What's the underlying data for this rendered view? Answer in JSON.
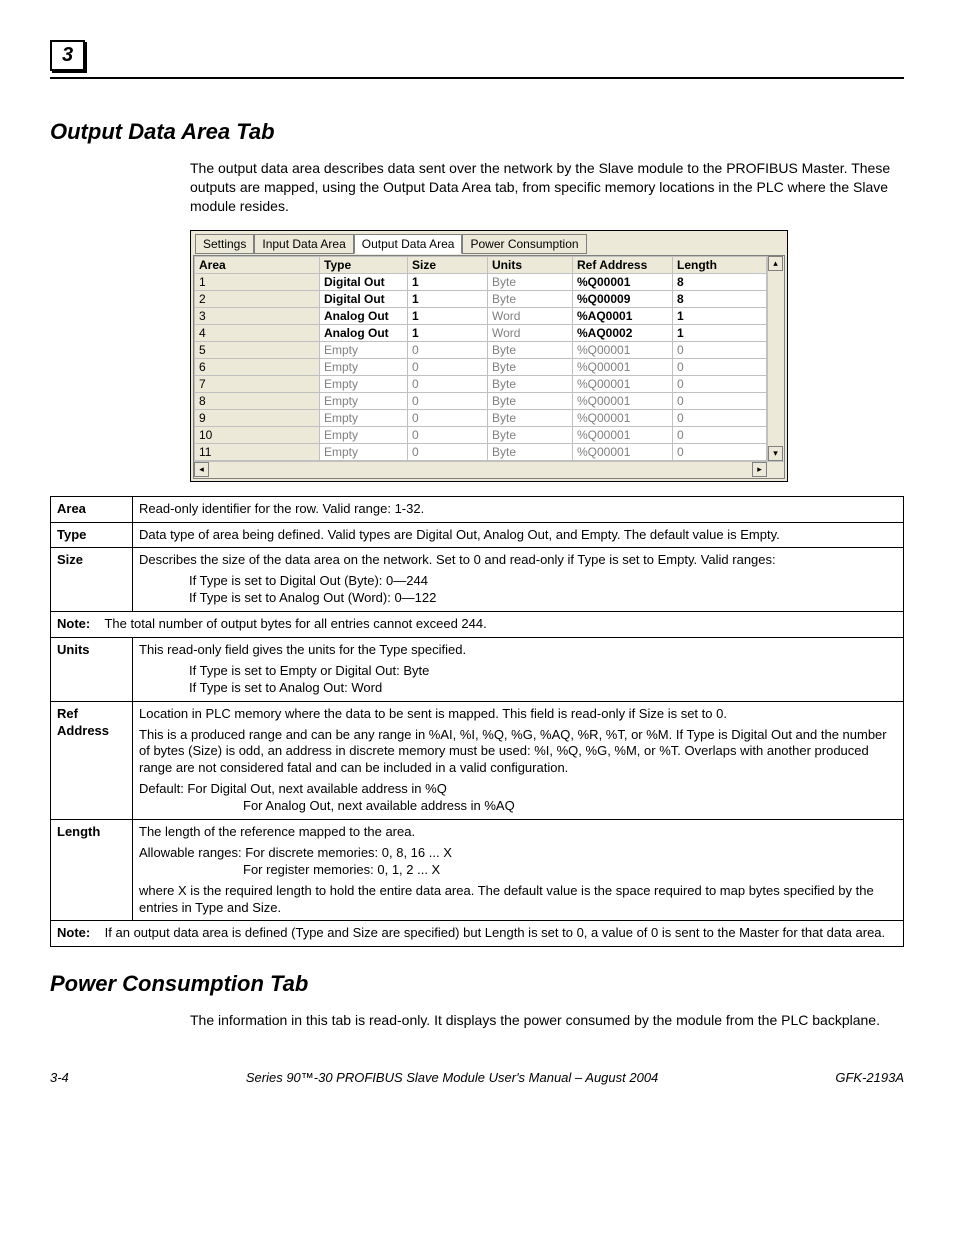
{
  "chapter_badge": "3",
  "section1_title": "Output Data Area Tab",
  "section1_para": "The output data area describes data sent over the network by the Slave module to the PROFIBUS Master. These outputs are mapped, using the Output Data Area tab, from specific memory locations in the PLC where the Slave module resides.",
  "tabs": {
    "settings": "Settings",
    "input": "Input Data Area",
    "output": "Output Data Area",
    "power": "Power Consumption"
  },
  "grid_headers": {
    "area": "Area",
    "type": "Type",
    "size": "Size",
    "units": "Units",
    "ref": "Ref Address",
    "len": "Length"
  },
  "rows": [
    {
      "n": "1",
      "type": "Digital Out",
      "tb": true,
      "size": "1",
      "sb": true,
      "units": "Byte",
      "ud": true,
      "ref": "%Q00001",
      "rb": true,
      "len": "8",
      "lb": true
    },
    {
      "n": "2",
      "type": "Digital Out",
      "tb": true,
      "size": "1",
      "sb": true,
      "units": "Byte",
      "ud": true,
      "ref": "%Q00009",
      "rb": true,
      "len": "8",
      "lb": true
    },
    {
      "n": "3",
      "type": "Analog Out",
      "tb": true,
      "size": "1",
      "sb": true,
      "units": "Word",
      "ud": true,
      "ref": "%AQ0001",
      "rb": true,
      "len": "1",
      "lb": true
    },
    {
      "n": "4",
      "type": "Analog Out",
      "tb": true,
      "size": "1",
      "sb": true,
      "units": "Word",
      "ud": true,
      "ref": "%AQ0002",
      "rb": true,
      "len": "1",
      "lb": true
    },
    {
      "n": "5",
      "type": "Empty",
      "tb": false,
      "size": "0",
      "sb": false,
      "units": "Byte",
      "ud": true,
      "ref": "%Q00001",
      "rb": false,
      "len": "0",
      "lb": false
    },
    {
      "n": "6",
      "type": "Empty",
      "tb": false,
      "size": "0",
      "sb": false,
      "units": "Byte",
      "ud": true,
      "ref": "%Q00001",
      "rb": false,
      "len": "0",
      "lb": false
    },
    {
      "n": "7",
      "type": "Empty",
      "tb": false,
      "size": "0",
      "sb": false,
      "units": "Byte",
      "ud": true,
      "ref": "%Q00001",
      "rb": false,
      "len": "0",
      "lb": false
    },
    {
      "n": "8",
      "type": "Empty",
      "tb": false,
      "size": "0",
      "sb": false,
      "units": "Byte",
      "ud": true,
      "ref": "%Q00001",
      "rb": false,
      "len": "0",
      "lb": false
    },
    {
      "n": "9",
      "type": "Empty",
      "tb": false,
      "size": "0",
      "sb": false,
      "units": "Byte",
      "ud": true,
      "ref": "%Q00001",
      "rb": false,
      "len": "0",
      "lb": false
    },
    {
      "n": "10",
      "type": "Empty",
      "tb": false,
      "size": "0",
      "sb": false,
      "units": "Byte",
      "ud": true,
      "ref": "%Q00001",
      "rb": false,
      "len": "0",
      "lb": false
    },
    {
      "n": "11",
      "type": "Empty",
      "tb": false,
      "size": "0",
      "sb": false,
      "units": "Byte",
      "ud": true,
      "ref": "%Q00001",
      "rb": false,
      "len": "0",
      "lb": false
    }
  ],
  "def": {
    "area_k": "Area",
    "area_v": "Read-only identifier for the row. Valid range: 1-32.",
    "type_k": "Type",
    "type_v": "Data type of area being defined. Valid types are Digital Out, Analog Out, and Empty. The default value is Empty.",
    "size_k": "Size",
    "size_v1": "Describes the size of the data area on the network. Set to 0 and read-only if Type is set to Empty. Valid ranges:",
    "size_v2": "If Type is set to Digital Out (Byte): 0—244",
    "size_v3": "If Type is set to Analog Out (Word): 0—122",
    "note1_k": "Note:",
    "note1_v": "The total number of output bytes for all entries cannot exceed 244.",
    "units_k": "Units",
    "units_v1": "This read-only field gives the units for the Type specified.",
    "units_v2": "If Type is set to Empty or Digital Out: Byte",
    "units_v3": "If Type is set to Analog Out: Word",
    "ref_k": "Ref Address",
    "ref_v1": "Location in PLC memory where the data to be sent is mapped. This field is read-only if Size is set to 0.",
    "ref_v2": "This is a produced range and can be any range in %AI, %I, %Q, %G, %AQ, %R, %T, or %M. If Type is Digital Out and the number of bytes (Size) is odd, an address in discrete memory must be used: %I, %Q, %G, %M, or %T. Overlaps with another produced range are not considered fatal and can be included in a valid configuration.",
    "ref_v3": "Default:  For Digital Out, next available address in %Q",
    "ref_v4": "For Analog Out, next available address in %AQ",
    "len_k": "Length",
    "len_v1": "The length of the reference mapped to the area.",
    "len_v2a": "Allowable ranges: ",
    "len_v2b": "For discrete memories: 0, 8, 16 ... X",
    "len_v2c": "For register memories: 0, 1, 2 ... X",
    "len_v3": "where X is the required length to hold the entire data area. The default value is the space required to map bytes specified by the entries in Type and Size.",
    "note2_k": "Note:",
    "note2_v": "If an output data area is defined (Type and Size are specified) but Length is set to 0, a value of 0 is sent to the Master for that data area."
  },
  "section2_title": "Power Consumption Tab",
  "section2_para": "The information in this tab is read-only. It displays the power consumed by the module from the PLC backplane.",
  "footer": {
    "page": "3-4",
    "title": "Series 90™-30 PROFIBUS Slave Module User's Manual  – August 2004",
    "doc": "GFK-2193A"
  }
}
